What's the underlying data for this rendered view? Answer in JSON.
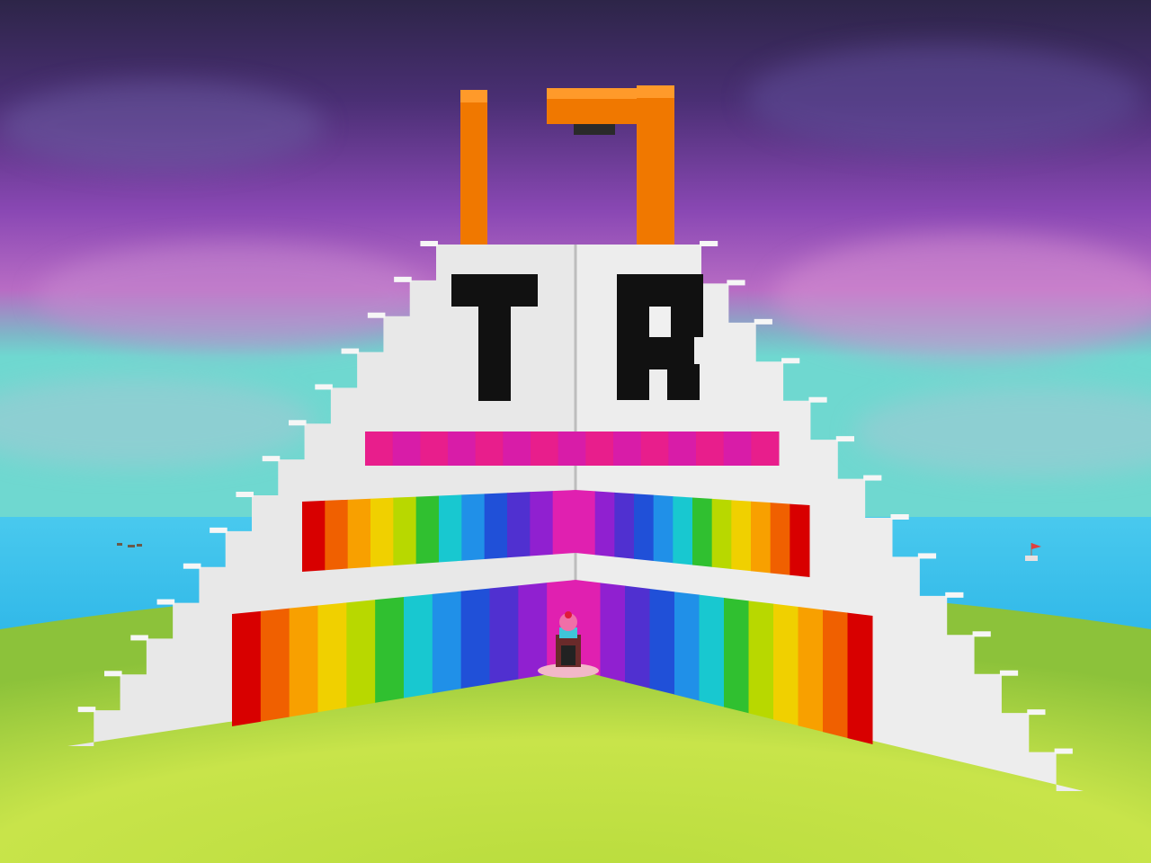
{
  "scene": {
    "description_colors": {
      "sky_top": "#3b2a5e",
      "sky_mid": "#8a4fb0",
      "sky_low": "#c47ac8",
      "horizon": "#7fd6cf",
      "sea": "#39c6ec",
      "grass_light": "#cfe84a",
      "grass_dark": "#8cc23a",
      "wall": "#e8e8e8",
      "wall_shade": "#cfcfcf",
      "letters": "#111111",
      "orange": "#f07800",
      "magenta": "#e0209a"
    },
    "rainbow": [
      "#d80000",
      "#f06000",
      "#f8a000",
      "#f0d000",
      "#b8d800",
      "#30c030",
      "#18c8d0",
      "#2090e8",
      "#2050d8",
      "#5030d0",
      "#9020d0",
      "#e020b0"
    ],
    "magenta_band": [
      "#e81e8c",
      "#d81ca8",
      "#e81e8c",
      "#d81ca8"
    ],
    "wall_letters": [
      {
        "left": "T",
        "right": "R"
      }
    ]
  }
}
